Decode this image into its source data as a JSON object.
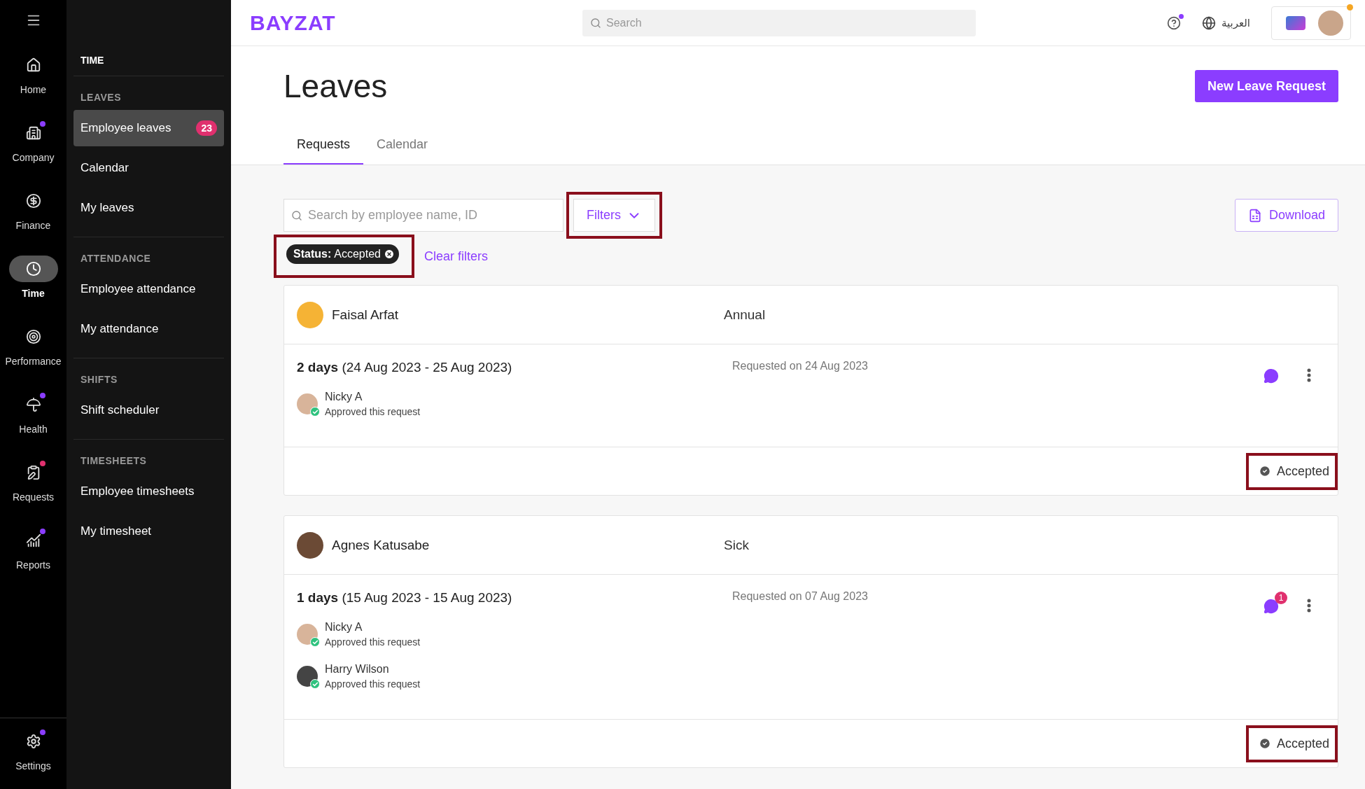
{
  "rail": {
    "items": [
      {
        "label": "Home",
        "selected": false
      },
      {
        "label": "Company",
        "selected": false,
        "color": "#8b3dff"
      },
      {
        "label": "Finance",
        "selected": false
      },
      {
        "label": "Time",
        "selected": true
      },
      {
        "label": "Performance",
        "selected": false
      },
      {
        "label": "Health",
        "selected": false,
        "color": "#8b3dff"
      },
      {
        "label": "Requests",
        "selected": false,
        "color": "#e0306e"
      },
      {
        "label": "Reports",
        "selected": false,
        "color": "#8b3dff"
      }
    ],
    "settings": {
      "label": "Settings",
      "color": "#8b3dff"
    }
  },
  "submenu": {
    "title": "TIME",
    "sections": [
      {
        "heading": "LEAVES",
        "items": [
          {
            "label": "Employee leaves",
            "selected": true,
            "badge": "23"
          },
          {
            "label": "Calendar",
            "selected": false
          },
          {
            "label": "My leaves",
            "selected": false
          }
        ]
      },
      {
        "heading": "ATTENDANCE",
        "items": [
          {
            "label": "Employee attendance",
            "selected": false
          },
          {
            "label": "My attendance",
            "selected": false
          }
        ]
      },
      {
        "heading": "SHIFTS",
        "items": [
          {
            "label": "Shift scheduler",
            "selected": false
          }
        ]
      },
      {
        "heading": "TIMESHEETS",
        "items": [
          {
            "label": "Employee timesheets",
            "selected": false
          },
          {
            "label": "My timesheet",
            "selected": false
          }
        ]
      }
    ]
  },
  "topbar": {
    "logo": "BAYZAT",
    "search_placeholder": "Search",
    "language": "العربية"
  },
  "page": {
    "title": "Leaves",
    "primary_button": "New Leave Request",
    "tabs": [
      {
        "label": "Requests",
        "selected": true
      },
      {
        "label": "Calendar",
        "selected": false
      }
    ],
    "search_placeholder": "Search by employee name, ID",
    "filters": {
      "label": "Filters",
      "highlighted": true
    },
    "download": "Download",
    "chip": {
      "key": "Status:",
      "value": "Accepted",
      "highlighted": true
    },
    "clear": "Clear filters"
  },
  "requests": [
    {
      "name": "Faisal Arfat",
      "type": "Annual",
      "duration": "2 days",
      "range": "(24 Aug 2023 - 25 Aug 2023)",
      "requested": "Requested on 24 Aug 2023",
      "approvals": [
        {
          "name": "Nicky A",
          "note": "Approved this request"
        }
      ],
      "status": "Accepted",
      "highlighted": true
    },
    {
      "name": "Agnes Katusabe",
      "type": "Sick",
      "duration": "1 days",
      "range": "(15 Aug 2023 - 15 Aug 2023)",
      "requested": "Requested on 07 Aug 2023",
      "comments": "1",
      "approvals": [
        {
          "name": "Nicky A",
          "note": "Approved this request"
        },
        {
          "name": "Harry Wilson",
          "note": "Approved this request"
        }
      ],
      "status": "Accepted",
      "highlighted": true
    }
  ]
}
